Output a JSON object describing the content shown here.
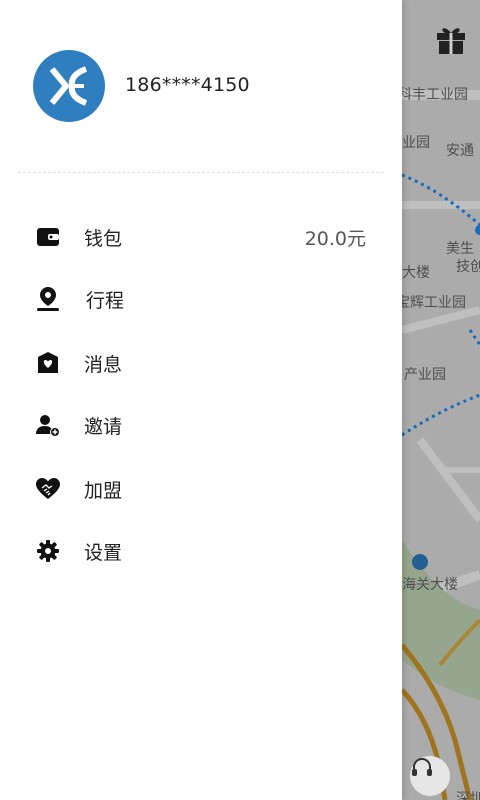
{
  "user": {
    "phone": "186****4150"
  },
  "menu": [
    {
      "label": "钱包",
      "icon": "wallet-icon",
      "value": "20.0元"
    },
    {
      "label": "行程",
      "icon": "location-pin-icon"
    },
    {
      "label": "消息",
      "icon": "message-heart-icon"
    },
    {
      "label": "邀请",
      "icon": "add-user-icon"
    },
    {
      "label": "加盟",
      "icon": "handshake-heart-icon"
    },
    {
      "label": "设置",
      "icon": "gear-icon"
    }
  ],
  "map": {
    "labels": [
      "科丰工业园",
      "业园",
      "安通",
      "美生",
      "技创",
      "大楼",
      "宝辉工业园",
      "产业园",
      "海关大楼",
      "深圳"
    ]
  },
  "colors": {
    "avatar": "#2f7fc0",
    "route": "#1e90ff"
  }
}
